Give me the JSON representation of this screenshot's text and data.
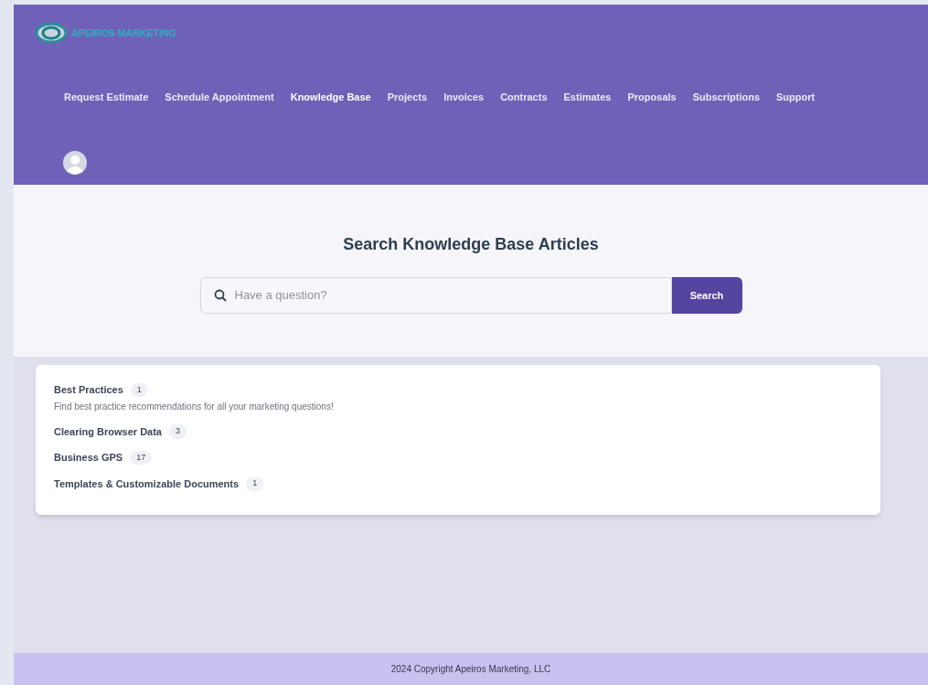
{
  "header": {
    "logo_text": "APEIROS MARKETING",
    "nav": [
      {
        "label": "Request Estimate",
        "selected": false
      },
      {
        "label": "Schedule Appointment",
        "selected": false
      },
      {
        "label": "Knowledge Base",
        "selected": true
      },
      {
        "label": "Projects",
        "selected": false
      },
      {
        "label": "Invoices",
        "selected": false
      },
      {
        "label": "Contracts",
        "selected": false
      },
      {
        "label": "Estimates",
        "selected": false
      },
      {
        "label": "Proposals",
        "selected": false
      },
      {
        "label": "Subscriptions",
        "selected": false
      },
      {
        "label": "Support",
        "selected": false
      }
    ]
  },
  "search": {
    "title": "Search Knowledge Base Articles",
    "placeholder": "Have a question?",
    "button": "Search"
  },
  "categories": [
    {
      "name": "Best Practices",
      "count": "1",
      "description": "Find best practice recommendations for all your marketing questions!"
    },
    {
      "name": "Clearing Browser Data",
      "count": "3"
    },
    {
      "name": "Business GPS",
      "count": "17"
    },
    {
      "name": "Templates & Customizable Documents",
      "count": "1"
    }
  ],
  "footer": {
    "text": "2024 Copyright Apeiros Marketing, LLC"
  }
}
